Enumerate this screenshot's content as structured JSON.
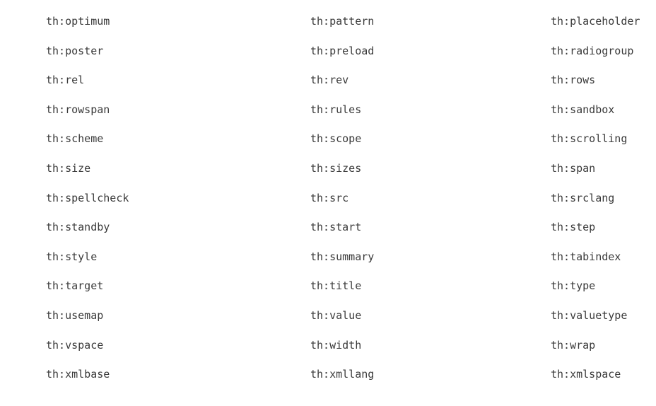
{
  "attributes": {
    "rows": [
      [
        "th:optimum",
        "th:pattern",
        "th:placeholder"
      ],
      [
        "th:poster",
        "th:preload",
        "th:radiogroup"
      ],
      [
        "th:rel",
        "th:rev",
        "th:rows"
      ],
      [
        "th:rowspan",
        "th:rules",
        "th:sandbox"
      ],
      [
        "th:scheme",
        "th:scope",
        "th:scrolling"
      ],
      [
        "th:size",
        "th:sizes",
        "th:span"
      ],
      [
        "th:spellcheck",
        "th:src",
        "th:srclang"
      ],
      [
        "th:standby",
        "th:start",
        "th:step"
      ],
      [
        "th:style",
        "th:summary",
        "th:tabindex"
      ],
      [
        "th:target",
        "th:title",
        "th:type"
      ],
      [
        "th:usemap",
        "th:value",
        "th:valuetype"
      ],
      [
        "th:vspace",
        "th:width",
        "th:wrap"
      ],
      [
        "th:xmlbase",
        "th:xmllang",
        "th:xmlspace"
      ]
    ]
  }
}
